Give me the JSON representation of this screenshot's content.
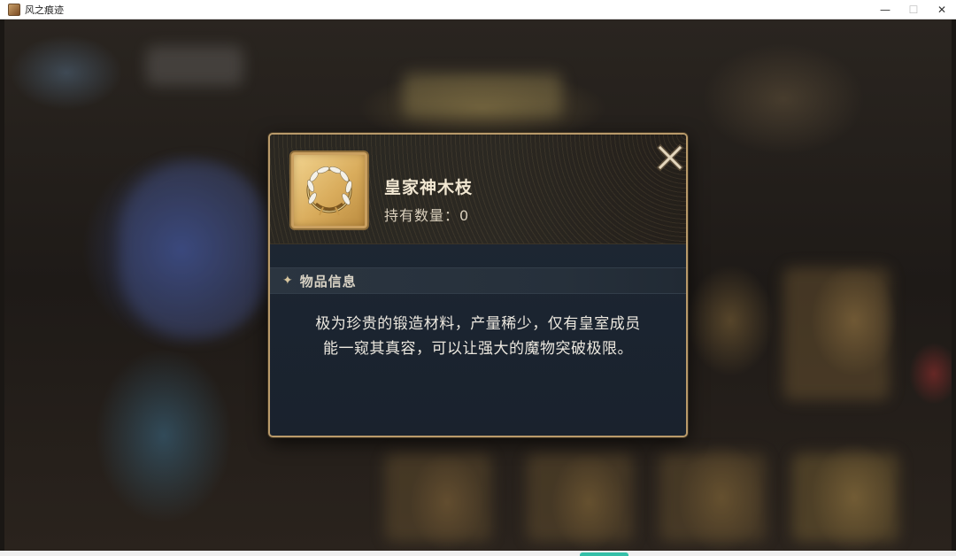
{
  "window": {
    "title": "风之痕迹",
    "controls": {
      "minimize": "—",
      "restore": "☐",
      "close": "✕"
    }
  },
  "dialog": {
    "close_icon": "close-x-icon",
    "item": {
      "name": "皇家神木枝",
      "quantity_label": "持有数量：",
      "quantity_value": "0",
      "icon": "laurel-wreath-icon"
    },
    "section": {
      "title": "物品信息",
      "icon": "sparkle-icon"
    },
    "description_lines": [
      "极为珍贵的锻造材料，产量稀少，仅有皇室成员",
      "能一窥其真容，可以让强大的魔物突破极限。"
    ]
  },
  "colors": {
    "dialog_border": "#b99a6a",
    "dialog_bg": "#1b2430",
    "item_frame_gold": "#d9ac5c",
    "text_primary": "#f1e7d2",
    "taskbar_accent": "#34c0a8"
  }
}
